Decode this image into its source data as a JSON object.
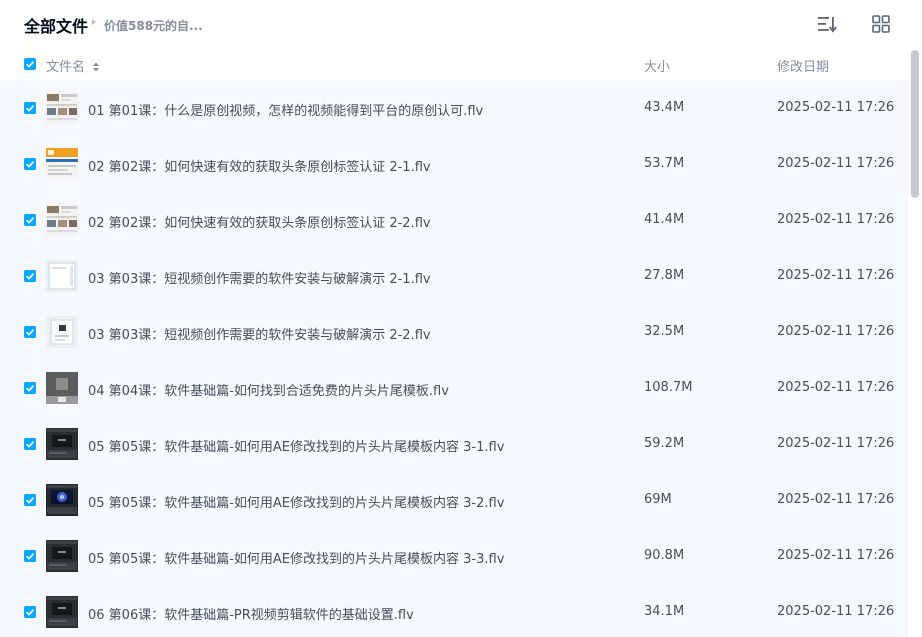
{
  "header": {
    "title": "全部文件",
    "breadcrumb": "价值588元的自...",
    "sort_icon": "sort-lines-icon",
    "grid_icon": "grid-view-icon"
  },
  "columns": {
    "name": "文件名",
    "size": "大小",
    "modified": "修改日期"
  },
  "colors": {
    "accent": "#06a7ff",
    "row_selected_bg": "#f5f9ff",
    "text": "#454d5a",
    "muted": "#878c9c"
  },
  "files": [
    {
      "name": "01 第01课：什么是原创视频，怎样的视频能得到平台的原创认可.flv",
      "size": "43.4M",
      "date": "2025-02-11 17:26",
      "thumb": "web-collage",
      "checked": true
    },
    {
      "name": "02 第02课：如何快速有效的获取头条原创标签认证 2-1.flv",
      "size": "53.7M",
      "date": "2025-02-11 17:26",
      "thumb": "orange-web",
      "checked": true
    },
    {
      "name": "02 第02课：如何快速有效的获取头条原创标签认证 2-2.flv",
      "size": "41.4M",
      "date": "2025-02-11 17:26",
      "thumb": "web-collage",
      "checked": true
    },
    {
      "name": "03 第03课：短视频创作需要的软件安装与破解演示 2-1.flv",
      "size": "27.8M",
      "date": "2025-02-11 17:26",
      "thumb": "light-dialog",
      "checked": true
    },
    {
      "name": "03 第03课：短视频创作需要的软件安装与破解演示 2-2.flv",
      "size": "32.5M",
      "date": "2025-02-11 17:26",
      "thumb": "light-dialog-dark",
      "checked": true
    },
    {
      "name": "04 第04课：软件基础篇-如何找到合适免费的片头片尾模板.flv",
      "size": "108.7M",
      "date": "2025-02-11 17:26",
      "thumb": "gray-box",
      "checked": true
    },
    {
      "name": "05 第05课：软件基础篇-如何用AE修改找到的片头片尾模板内容 3-1.flv",
      "size": "59.2M",
      "date": "2025-02-11 17:26",
      "thumb": "dark-editor",
      "checked": true
    },
    {
      "name": "05 第05课：软件基础篇-如何用AE修改找到的片头片尾模板内容 3-2.flv",
      "size": "69M",
      "date": "2025-02-11 17:26",
      "thumb": "dark-editor-blue",
      "checked": true
    },
    {
      "name": "05 第05课：软件基础篇-如何用AE修改找到的片头片尾模板内容 3-3.flv",
      "size": "90.8M",
      "date": "2025-02-11 17:26",
      "thumb": "dark-editor",
      "checked": true
    },
    {
      "name": "06 第06课：软件基础篇-PR视频剪辑软件的基础设置.flv",
      "size": "34.1M",
      "date": "2025-02-11 17:26",
      "thumb": "dark-editor",
      "checked": true
    }
  ]
}
